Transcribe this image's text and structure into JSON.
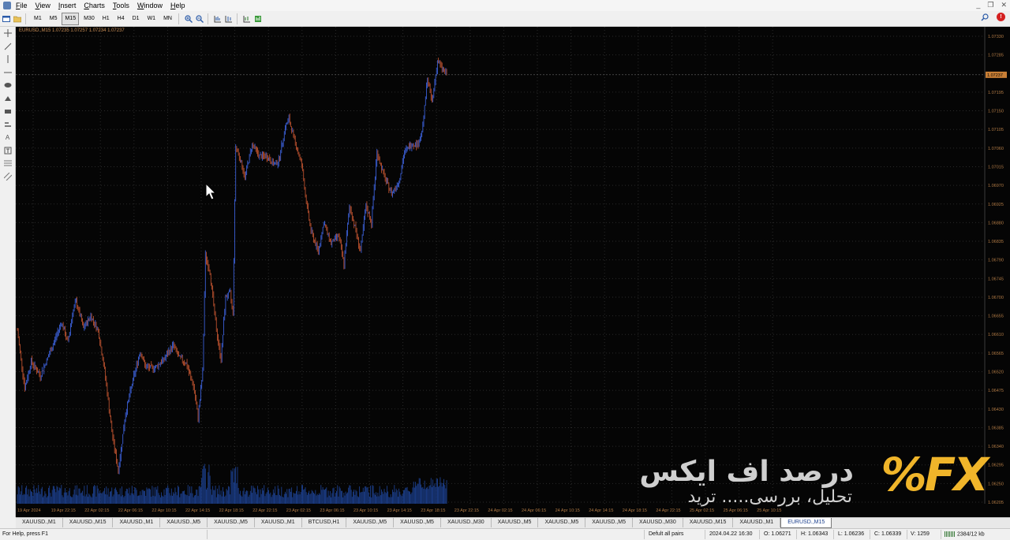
{
  "menu": [
    "File",
    "View",
    "Insert",
    "Charts",
    "Tools",
    "Window",
    "Help"
  ],
  "toolbar": {
    "timeframes": [
      "M1",
      "M5",
      "M15",
      "M30",
      "H1",
      "H4",
      "D1",
      "W1",
      "MN"
    ],
    "selected_timeframe": "M15"
  },
  "chart": {
    "header": "EURUSD.,M15  1.07235 1.07257 1.07234 1.07237",
    "current_price": "1.07237",
    "price_labels": [
      "1.07330",
      "1.07285",
      "1.07195",
      "1.07150",
      "1.07105",
      "1.07060",
      "1.07015",
      "1.06970",
      "1.06925",
      "1.06880",
      "1.06835",
      "1.06790",
      "1.06745",
      "1.06700",
      "1.06655",
      "1.06610",
      "1.06565",
      "1.06520",
      "1.06475",
      "1.06430",
      "1.06385",
      "1.06340",
      "1.06295",
      "1.06250",
      "1.06205"
    ],
    "time_labels": [
      "19 Apr 2024",
      "19 Apr 22:15",
      "22 Apr 02:15",
      "22 Apr 06:15",
      "22 Apr 10:15",
      "22 Apr 14:15",
      "22 Apr 18:15",
      "22 Apr 22:15",
      "23 Apr 02:15",
      "23 Apr 06:15",
      "23 Apr 10:15",
      "23 Apr 14:15",
      "23 Apr 18:15",
      "23 Apr 22:15",
      "24 Apr 02:15",
      "24 Apr 06:15",
      "24 Apr 10:15",
      "24 Apr 14:15",
      "24 Apr 18:15",
      "24 Apr 22:15",
      "25 Apr 02:15",
      "25 Apr 06:15",
      "25 Apr 10:15"
    ],
    "colors": {
      "background": "#050505",
      "bull": "#3b5fd6",
      "bear": "#b8502e",
      "grid": "#2a2a2a",
      "volume": "#1c3f8c",
      "axis_text": "#b07a45",
      "price_tag": "#c97f36"
    }
  },
  "watermark": {
    "logo": "%FX",
    "title_fa": "درصد اف ایکس",
    "subtitle_fa": "تحلیل، بررسی..... ترید"
  },
  "tabs": [
    "XAUUSD.,M1",
    "XAUUSD.,M15",
    "XAUUSD.,M1",
    "XAUUSD.,M5",
    "XAUUSD.,M5",
    "XAUUSD.,M1",
    "BTCUSD,H1",
    "XAUUSD.,M5",
    "XAUUSD.,M5",
    "XAUUSD.,M30",
    "XAUUSD.,M5",
    "XAUUSD.,M5",
    "XAUUSD.,M5",
    "XAUUSD.,M30",
    "XAUUSD.,M15",
    "XAUUSD.,M1",
    "EURUSD.,M15"
  ],
  "active_tab": "EURUSD.,M15",
  "status": {
    "help": "For Help, press F1",
    "profile": "Defult all pairs",
    "datetime": "2024.04.22 16:30",
    "open": "O: 1.06271",
    "high": "H: 1.06343",
    "low": "L: 1.06236",
    "close": "C: 1.06339",
    "volume": "V: 1259",
    "traffic": "2384/12 kb"
  }
}
